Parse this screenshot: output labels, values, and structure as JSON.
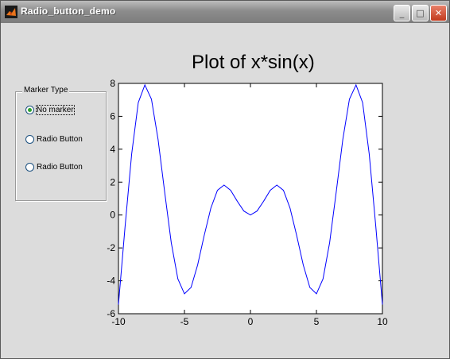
{
  "window": {
    "title": "Radio_button_demo",
    "buttons": {
      "minimize": "_",
      "maximize": "□",
      "close": "✕"
    }
  },
  "marker_group": {
    "legend": "Marker Type",
    "options": [
      "No marker",
      "Radio Button",
      "Radio Button"
    ],
    "selected_index": 0
  },
  "colors": {
    "line": "#0000ff",
    "axes_bg": "#ffffff",
    "figure_bg": "#dcdcdc"
  },
  "chart_data": {
    "type": "line",
    "title": "Plot of x*sin(x)",
    "xlabel": "",
    "ylabel": "",
    "xlim": [
      -10,
      10
    ],
    "ylim": [
      -6,
      8
    ],
    "xticks": [
      -10,
      -5,
      0,
      5,
      10
    ],
    "yticks": [
      -6,
      -4,
      -2,
      0,
      2,
      4,
      6,
      8
    ],
    "grid": false,
    "series": [
      {
        "x": [
          -10,
          -9.5,
          -9,
          -8.5,
          -8,
          -7.5,
          -7,
          -6.5,
          -6,
          -5.5,
          -5,
          -4.5,
          -4,
          -3.5,
          -3,
          -2.5,
          -2,
          -1.5,
          -1,
          -0.5,
          0,
          0.5,
          1,
          1.5,
          2,
          2.5,
          3,
          3.5,
          4,
          4.5,
          5,
          5.5,
          6,
          6.5,
          7,
          7.5,
          8,
          8.5,
          9,
          9.5,
          10
        ],
        "y": [
          -5.44,
          -0.71,
          3.71,
          6.83,
          7.91,
          7.04,
          4.6,
          1.4,
          -1.68,
          -3.88,
          -4.79,
          -4.4,
          -3.03,
          -1.23,
          0.42,
          1.5,
          1.82,
          1.5,
          0.84,
          0.24,
          0,
          0.24,
          0.84,
          1.5,
          1.82,
          1.5,
          0.42,
          -1.23,
          -3.03,
          -4.4,
          -4.79,
          -3.88,
          -1.68,
          1.4,
          4.6,
          7.04,
          7.91,
          6.83,
          3.71,
          -0.71,
          -5.44
        ]
      }
    ]
  }
}
